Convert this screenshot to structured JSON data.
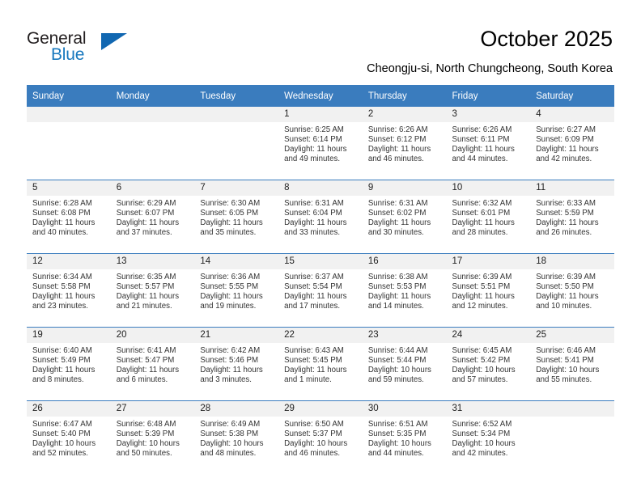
{
  "brand": {
    "name_part1": "General",
    "name_part2": "Blue",
    "accent_color": "#1167b1"
  },
  "header": {
    "title": "October 2025",
    "subtitle": "Cheongju-si, North Chungcheong, South Korea"
  },
  "calendar": {
    "header_bg": "#3a7cbe",
    "daynum_bg": "#f1f1f1",
    "weekday_headers": [
      "Sunday",
      "Monday",
      "Tuesday",
      "Wednesday",
      "Thursday",
      "Friday",
      "Saturday"
    ],
    "weeks": [
      [
        {
          "day": "",
          "blank": true
        },
        {
          "day": "",
          "blank": true
        },
        {
          "day": "",
          "blank": true
        },
        {
          "day": "1",
          "sunrise": "Sunrise: 6:25 AM",
          "sunset": "Sunset: 6:14 PM",
          "daylight1": "Daylight: 11 hours",
          "daylight2": "and 49 minutes."
        },
        {
          "day": "2",
          "sunrise": "Sunrise: 6:26 AM",
          "sunset": "Sunset: 6:12 PM",
          "daylight1": "Daylight: 11 hours",
          "daylight2": "and 46 minutes."
        },
        {
          "day": "3",
          "sunrise": "Sunrise: 6:26 AM",
          "sunset": "Sunset: 6:11 PM",
          "daylight1": "Daylight: 11 hours",
          "daylight2": "and 44 minutes."
        },
        {
          "day": "4",
          "sunrise": "Sunrise: 6:27 AM",
          "sunset": "Sunset: 6:09 PM",
          "daylight1": "Daylight: 11 hours",
          "daylight2": "and 42 minutes."
        }
      ],
      [
        {
          "day": "5",
          "sunrise": "Sunrise: 6:28 AM",
          "sunset": "Sunset: 6:08 PM",
          "daylight1": "Daylight: 11 hours",
          "daylight2": "and 40 minutes."
        },
        {
          "day": "6",
          "sunrise": "Sunrise: 6:29 AM",
          "sunset": "Sunset: 6:07 PM",
          "daylight1": "Daylight: 11 hours",
          "daylight2": "and 37 minutes."
        },
        {
          "day": "7",
          "sunrise": "Sunrise: 6:30 AM",
          "sunset": "Sunset: 6:05 PM",
          "daylight1": "Daylight: 11 hours",
          "daylight2": "and 35 minutes."
        },
        {
          "day": "8",
          "sunrise": "Sunrise: 6:31 AM",
          "sunset": "Sunset: 6:04 PM",
          "daylight1": "Daylight: 11 hours",
          "daylight2": "and 33 minutes."
        },
        {
          "day": "9",
          "sunrise": "Sunrise: 6:31 AM",
          "sunset": "Sunset: 6:02 PM",
          "daylight1": "Daylight: 11 hours",
          "daylight2": "and 30 minutes."
        },
        {
          "day": "10",
          "sunrise": "Sunrise: 6:32 AM",
          "sunset": "Sunset: 6:01 PM",
          "daylight1": "Daylight: 11 hours",
          "daylight2": "and 28 minutes."
        },
        {
          "day": "11",
          "sunrise": "Sunrise: 6:33 AM",
          "sunset": "Sunset: 5:59 PM",
          "daylight1": "Daylight: 11 hours",
          "daylight2": "and 26 minutes."
        }
      ],
      [
        {
          "day": "12",
          "sunrise": "Sunrise: 6:34 AM",
          "sunset": "Sunset: 5:58 PM",
          "daylight1": "Daylight: 11 hours",
          "daylight2": "and 23 minutes."
        },
        {
          "day": "13",
          "sunrise": "Sunrise: 6:35 AM",
          "sunset": "Sunset: 5:57 PM",
          "daylight1": "Daylight: 11 hours",
          "daylight2": "and 21 minutes."
        },
        {
          "day": "14",
          "sunrise": "Sunrise: 6:36 AM",
          "sunset": "Sunset: 5:55 PM",
          "daylight1": "Daylight: 11 hours",
          "daylight2": "and 19 minutes."
        },
        {
          "day": "15",
          "sunrise": "Sunrise: 6:37 AM",
          "sunset": "Sunset: 5:54 PM",
          "daylight1": "Daylight: 11 hours",
          "daylight2": "and 17 minutes."
        },
        {
          "day": "16",
          "sunrise": "Sunrise: 6:38 AM",
          "sunset": "Sunset: 5:53 PM",
          "daylight1": "Daylight: 11 hours",
          "daylight2": "and 14 minutes."
        },
        {
          "day": "17",
          "sunrise": "Sunrise: 6:39 AM",
          "sunset": "Sunset: 5:51 PM",
          "daylight1": "Daylight: 11 hours",
          "daylight2": "and 12 minutes."
        },
        {
          "day": "18",
          "sunrise": "Sunrise: 6:39 AM",
          "sunset": "Sunset: 5:50 PM",
          "daylight1": "Daylight: 11 hours",
          "daylight2": "and 10 minutes."
        }
      ],
      [
        {
          "day": "19",
          "sunrise": "Sunrise: 6:40 AM",
          "sunset": "Sunset: 5:49 PM",
          "daylight1": "Daylight: 11 hours",
          "daylight2": "and 8 minutes."
        },
        {
          "day": "20",
          "sunrise": "Sunrise: 6:41 AM",
          "sunset": "Sunset: 5:47 PM",
          "daylight1": "Daylight: 11 hours",
          "daylight2": "and 6 minutes."
        },
        {
          "day": "21",
          "sunrise": "Sunrise: 6:42 AM",
          "sunset": "Sunset: 5:46 PM",
          "daylight1": "Daylight: 11 hours",
          "daylight2": "and 3 minutes."
        },
        {
          "day": "22",
          "sunrise": "Sunrise: 6:43 AM",
          "sunset": "Sunset: 5:45 PM",
          "daylight1": "Daylight: 11 hours",
          "daylight2": "and 1 minute."
        },
        {
          "day": "23",
          "sunrise": "Sunrise: 6:44 AM",
          "sunset": "Sunset: 5:44 PM",
          "daylight1": "Daylight: 10 hours",
          "daylight2": "and 59 minutes."
        },
        {
          "day": "24",
          "sunrise": "Sunrise: 6:45 AM",
          "sunset": "Sunset: 5:42 PM",
          "daylight1": "Daylight: 10 hours",
          "daylight2": "and 57 minutes."
        },
        {
          "day": "25",
          "sunrise": "Sunrise: 6:46 AM",
          "sunset": "Sunset: 5:41 PM",
          "daylight1": "Daylight: 10 hours",
          "daylight2": "and 55 minutes."
        }
      ],
      [
        {
          "day": "26",
          "sunrise": "Sunrise: 6:47 AM",
          "sunset": "Sunset: 5:40 PM",
          "daylight1": "Daylight: 10 hours",
          "daylight2": "and 52 minutes."
        },
        {
          "day": "27",
          "sunrise": "Sunrise: 6:48 AM",
          "sunset": "Sunset: 5:39 PM",
          "daylight1": "Daylight: 10 hours",
          "daylight2": "and 50 minutes."
        },
        {
          "day": "28",
          "sunrise": "Sunrise: 6:49 AM",
          "sunset": "Sunset: 5:38 PM",
          "daylight1": "Daylight: 10 hours",
          "daylight2": "and 48 minutes."
        },
        {
          "day": "29",
          "sunrise": "Sunrise: 6:50 AM",
          "sunset": "Sunset: 5:37 PM",
          "daylight1": "Daylight: 10 hours",
          "daylight2": "and 46 minutes."
        },
        {
          "day": "30",
          "sunrise": "Sunrise: 6:51 AM",
          "sunset": "Sunset: 5:35 PM",
          "daylight1": "Daylight: 10 hours",
          "daylight2": "and 44 minutes."
        },
        {
          "day": "31",
          "sunrise": "Sunrise: 6:52 AM",
          "sunset": "Sunset: 5:34 PM",
          "daylight1": "Daylight: 10 hours",
          "daylight2": "and 42 minutes."
        },
        {
          "day": "",
          "blank": true
        }
      ]
    ]
  }
}
